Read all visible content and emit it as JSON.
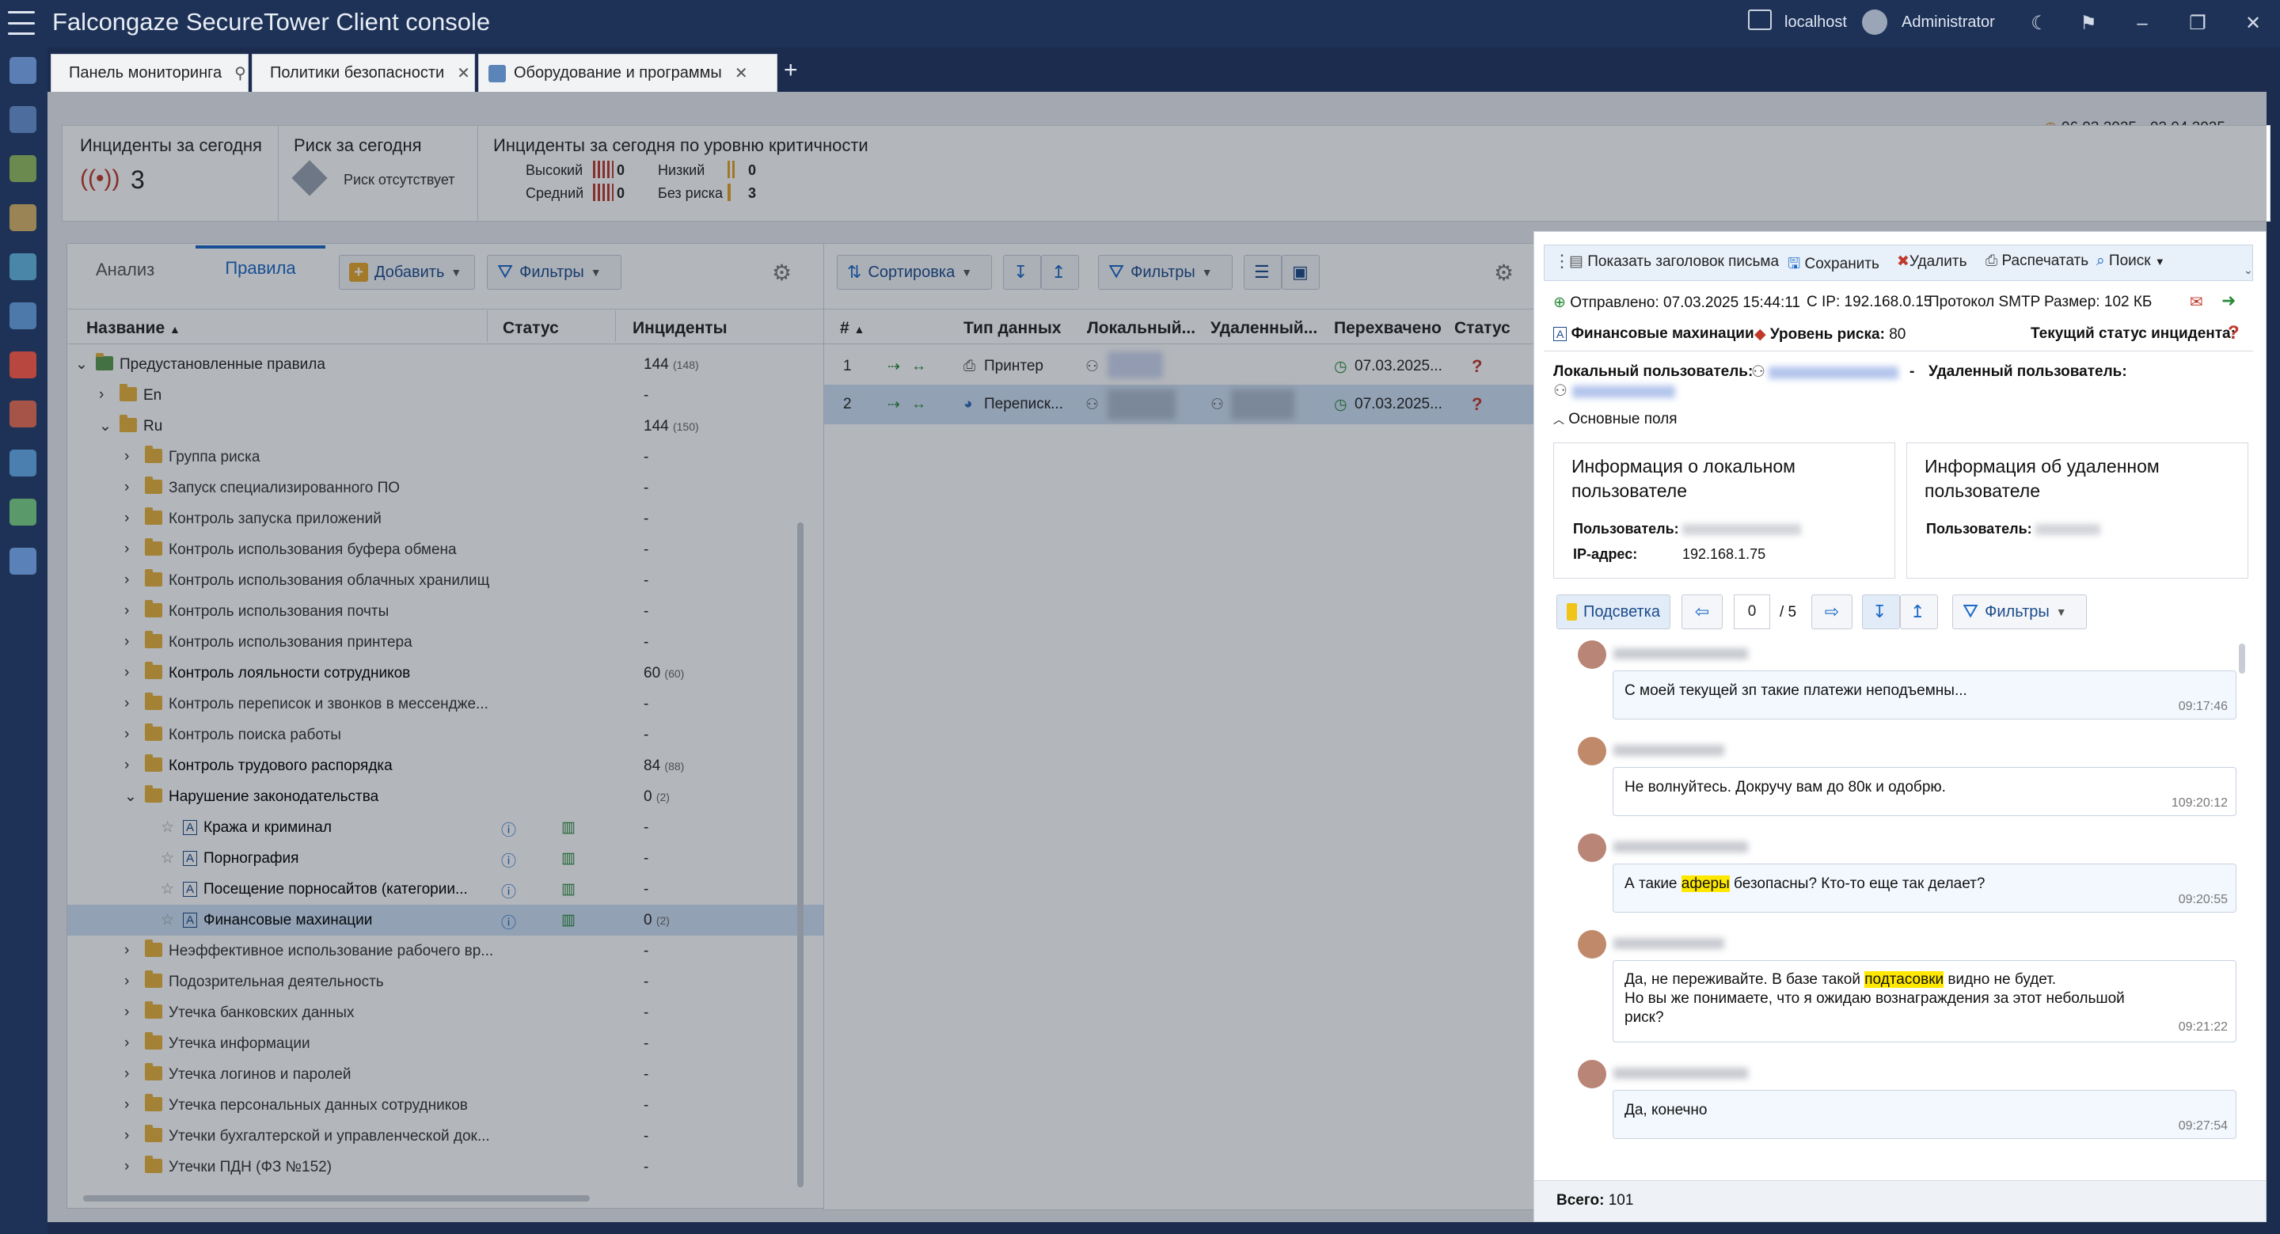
{
  "titlebar": {
    "brand": "Falcongaze SecureTower",
    "product": "Client console",
    "host": "localhost",
    "user": "Administrator"
  },
  "tabs": [
    {
      "label": "Панель мониторинга"
    },
    {
      "label": "Политики безопасности"
    },
    {
      "label": "Оборудование и программы"
    }
  ],
  "date_range": "06.03.2025 - 02.04.2025",
  "stats": {
    "incidents_today_title": "Инциденты за сегодня",
    "incidents_today_value": "3",
    "risk_title": "Риск за сегодня",
    "risk_value": "Риск отсутствует",
    "criticality_title": "Инциденты за сегодня по уровню критичности",
    "high_label": "Высокий",
    "high_value": "0",
    "medium_label": "Средний",
    "medium_value": "0",
    "low_label": "Низкий",
    "low_value": "0",
    "norisk_label": "Без риска",
    "norisk_value": "3"
  },
  "rules_panel": {
    "tab_analysis": "Анализ",
    "tab_rules": "Правила",
    "add_label": "Добавить",
    "filters_label": "Фильтры",
    "columns": {
      "name": "Название",
      "status": "Статус",
      "incidents": "Инциденты"
    },
    "rows": [
      {
        "label": "Предустановленные правила",
        "count": "144",
        "sub": "(148)"
      },
      {
        "label": "En",
        "count": "-",
        "sub": ""
      },
      {
        "label": "Ru",
        "count": "144",
        "sub": "(150)"
      },
      {
        "label": "Группа риска",
        "count": "-",
        "sub": ""
      },
      {
        "label": "Запуск специализированного ПО",
        "count": "-",
        "sub": ""
      },
      {
        "label": "Контроль запуска приложений",
        "count": "-",
        "sub": ""
      },
      {
        "label": "Контроль использования буфера обмена",
        "count": "-",
        "sub": ""
      },
      {
        "label": "Контроль использования облачных хранилищ",
        "count": "-",
        "sub": ""
      },
      {
        "label": "Контроль использования почты",
        "count": "-",
        "sub": ""
      },
      {
        "label": "Контроль использования принтера",
        "count": "-",
        "sub": ""
      },
      {
        "label": "Контроль лояльности сотрудников",
        "count": "60",
        "sub": "(60)"
      },
      {
        "label": "Контроль переписок и звонков в мессендже...",
        "count": "-",
        "sub": ""
      },
      {
        "label": "Контроль поиска работы",
        "count": "-",
        "sub": ""
      },
      {
        "label": "Контроль трудового распорядка",
        "count": "84",
        "sub": "(88)"
      },
      {
        "label": "Нарушение законодательства",
        "count": "0",
        "sub": "(2)"
      },
      {
        "label": "Кража и криминал",
        "count": "-",
        "sub": ""
      },
      {
        "label": "Порнография",
        "count": "-",
        "sub": ""
      },
      {
        "label": "Посещение порносайтов (категории...",
        "count": "-",
        "sub": ""
      },
      {
        "label": "Финансовые махинации",
        "count": "0",
        "sub": "(2)"
      },
      {
        "label": "Неэффективное использование рабочего вр...",
        "count": "-",
        "sub": ""
      },
      {
        "label": "Подозрительная деятельность",
        "count": "-",
        "sub": ""
      },
      {
        "label": "Утечка банковских данных",
        "count": "-",
        "sub": ""
      },
      {
        "label": "Утечка информации",
        "count": "-",
        "sub": ""
      },
      {
        "label": "Утечка логинов и паролей",
        "count": "-",
        "sub": ""
      },
      {
        "label": "Утечка персональных данных сотрудников",
        "count": "-",
        "sub": ""
      },
      {
        "label": "Утечки бухгалтерской и управленческой док...",
        "count": "-",
        "sub": ""
      },
      {
        "label": "Утечки ПДН (ФЗ №152)",
        "count": "-",
        "sub": ""
      }
    ]
  },
  "incidents_panel": {
    "sort_label": "Сортировка",
    "filters_label": "Фильтры",
    "columns": {
      "num": "#",
      "type": "Тип данных",
      "local": "Локальный...",
      "remote": "Удаленный...",
      "intercepted": "Перехвачено",
      "status": "Статус"
    },
    "rows": [
      {
        "num": "1",
        "type": "Принтер",
        "intercepted": "07.03.2025...",
        "status": "?"
      },
      {
        "num": "2",
        "type": "Переписк...",
        "intercepted": "07.03.2025...",
        "status": "?"
      }
    ]
  },
  "detail": {
    "toolbar": {
      "show_header": "Показать заголовок письма",
      "save": "Сохранить",
      "delete": "Удалить",
      "print": "Распечатать",
      "search": "Поиск"
    },
    "sent_label": "Отправлено:",
    "sent_value": "07.03.2025 15:44:11",
    "cip_label": "С IP:",
    "cip_value": "192.168.0.15",
    "protocol_label": "Протокол",
    "protocol_value": "SMTP",
    "size_label": "Размер:",
    "size_value": "102 КБ",
    "policy_name": "Финансовые махинации",
    "risk_label": "Уровень риска:",
    "risk_value": "80",
    "status_label": "Текущий статус инцидента:",
    "local_user_label": "Локальный пользователь:",
    "remote_user_label": "Удаленный пользователь:",
    "main_fields_label": "Основные поля",
    "local_card_title": "Информация о локальном пользователе",
    "remote_card_title": "Информация об удаленном пользователе",
    "user_label": "Пользователь:",
    "ip_label": "IP-адрес:",
    "ip_value": "192.168.1.75",
    "highlight_label": "Подсветка",
    "page_current": "0",
    "page_total": "/ 5",
    "filters_label": "Фильтры",
    "messages": [
      {
        "text": "С моей текущей зп такие платежи неподъемны...",
        "time": "09:17:46"
      },
      {
        "text": "Не волнуйтесь. Докручу вам до 80к и одобрю.",
        "time": "109:20:12"
      },
      {
        "pre": "А такие ",
        "hl": "аферы",
        "post": " безопасны? Кто-то еще так делает?",
        "time": "09:20:55"
      },
      {
        "pre": "Да, не переживайте. В базе такой ",
        "hl": "подтасовки",
        "post": " видно не будет.",
        "line2": "Но вы же понимаете, что я ожидаю вознаграждения за этот небольшой",
        "line3": "риск?",
        "time": "09:21:22"
      },
      {
        "text": "Да, конечно",
        "time": "09:27:54"
      }
    ],
    "total_label": "Всего:",
    "total_value": "101"
  }
}
